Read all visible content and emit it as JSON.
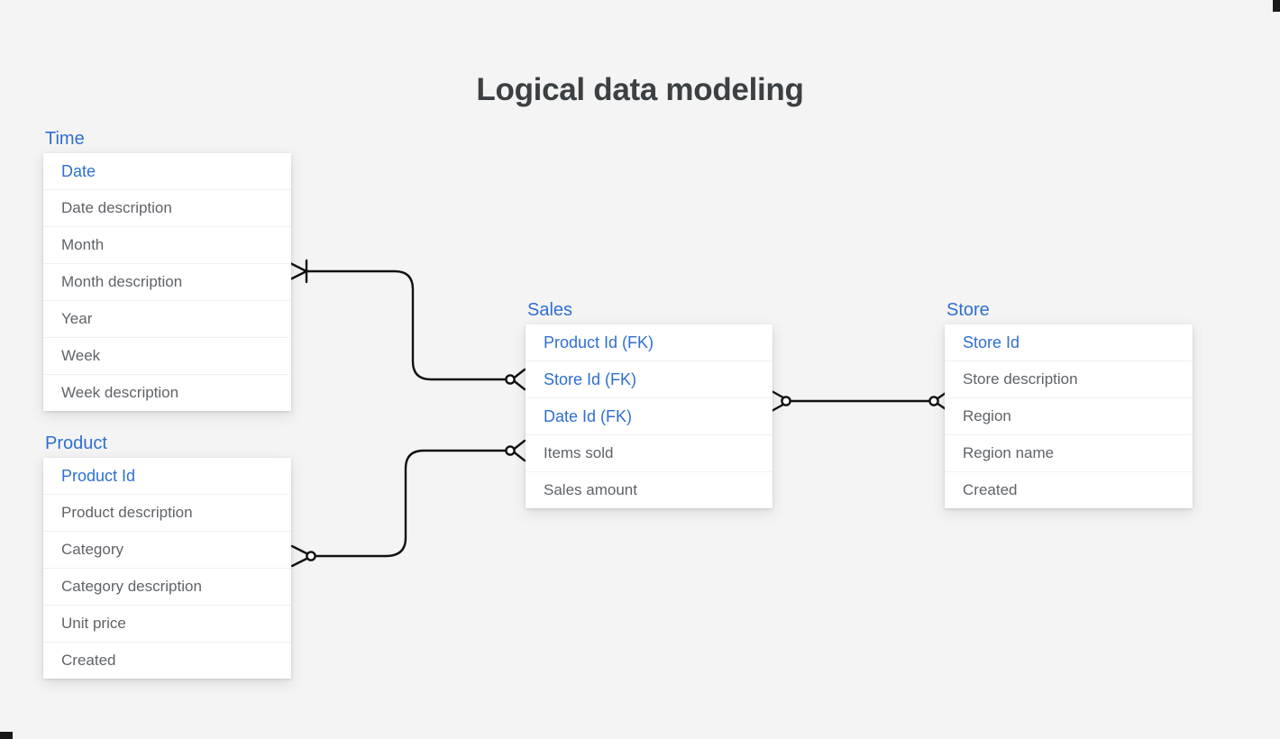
{
  "page": {
    "title": "Logical data modeling",
    "background_color": "#f4f4f4",
    "key_color": "#2f6fd0",
    "field_color": "#5f6368",
    "title_color": "#3c4043",
    "connector_color": "#111111"
  },
  "entities": [
    {
      "name": "Time",
      "fields": [
        {
          "label": "Date",
          "key": true
        },
        {
          "label": "Date description",
          "key": false
        },
        {
          "label": "Month",
          "key": false
        },
        {
          "label": "Month description",
          "key": false
        },
        {
          "label": "Year",
          "key": false
        },
        {
          "label": "Week",
          "key": false
        },
        {
          "label": "Week description",
          "key": false
        }
      ]
    },
    {
      "name": "Product",
      "fields": [
        {
          "label": "Product Id",
          "key": true
        },
        {
          "label": "Product description",
          "key": false
        },
        {
          "label": "Category",
          "key": false
        },
        {
          "label": "Category description",
          "key": false
        },
        {
          "label": "Unit price",
          "key": false
        },
        {
          "label": "Created",
          "key": false
        }
      ]
    },
    {
      "name": "Sales",
      "fields": [
        {
          "label": "Product Id (FK)",
          "key": true
        },
        {
          "label": "Store Id (FK)",
          "key": true
        },
        {
          "label": "Date Id (FK)",
          "key": true
        },
        {
          "label": "Items sold",
          "key": false
        },
        {
          "label": "Sales amount",
          "key": false
        }
      ]
    },
    {
      "name": "Store",
      "fields": [
        {
          "label": "Store Id",
          "key": true
        },
        {
          "label": "Store description",
          "key": false
        },
        {
          "label": "Region",
          "key": false
        },
        {
          "label": "Region name",
          "key": false
        },
        {
          "label": "Created",
          "key": false
        }
      ]
    }
  ],
  "relationships": [
    {
      "id": "time-sales",
      "from": "Time",
      "to": "Sales",
      "from_cardinality": "one-and-only-one",
      "to_cardinality": "zero-or-many"
    },
    {
      "id": "product-sales",
      "from": "Product",
      "to": "Sales",
      "from_cardinality": "zero-or-many",
      "to_cardinality": "zero-or-many"
    },
    {
      "id": "sales-store",
      "from": "Sales",
      "to": "Store",
      "from_cardinality": "zero-or-many",
      "to_cardinality": "zero-or-many"
    }
  ]
}
